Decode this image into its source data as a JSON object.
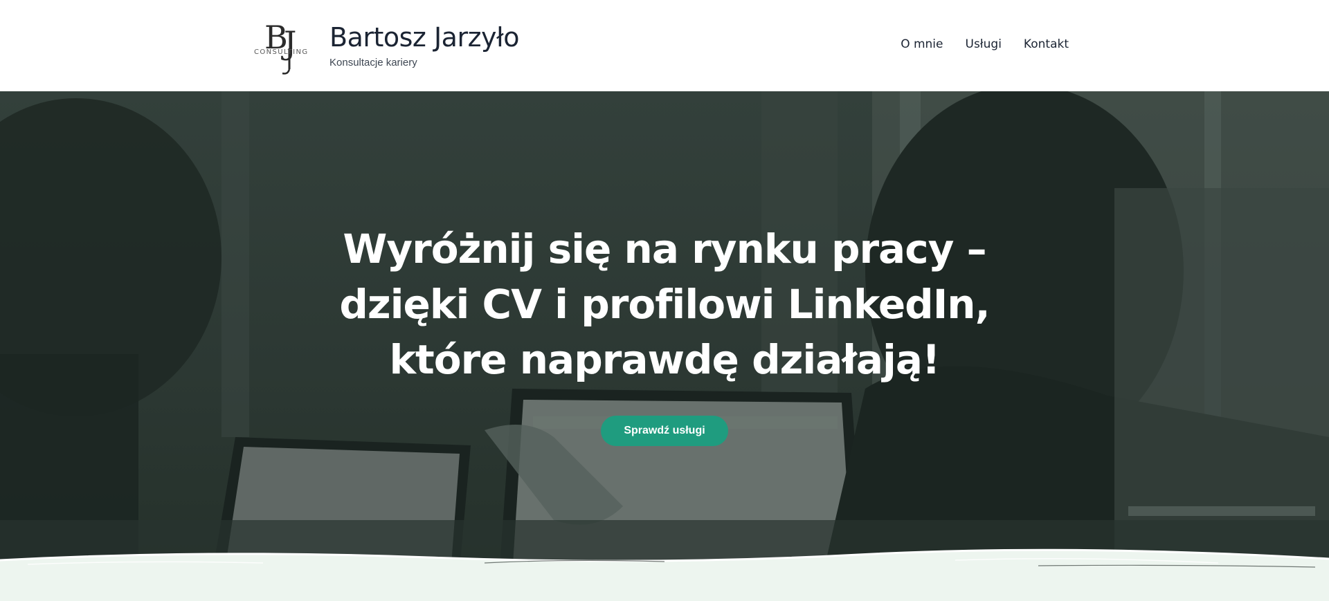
{
  "header": {
    "logo": {
      "monogram": "BJ",
      "wordmark": "CONSULTING"
    },
    "title": "Bartosz Jarzyło",
    "tagline": "Konsultacje kariery"
  },
  "nav": {
    "items": [
      {
        "label": "O mnie"
      },
      {
        "label": "Usługi"
      },
      {
        "label": "Kontakt"
      }
    ]
  },
  "hero": {
    "headline_lines": [
      "Wyróżnij się na rynku pracy –",
      "dzięki CV i profilowi LinkedIn,",
      "które naprawdę działają!"
    ],
    "cta_label": "Sprawdź usługi"
  },
  "colors": {
    "accent": "#1f9c7f",
    "hero_overlay": "#2c3833",
    "heading_text": "#1b2433",
    "section_background": "#edf5ef"
  }
}
